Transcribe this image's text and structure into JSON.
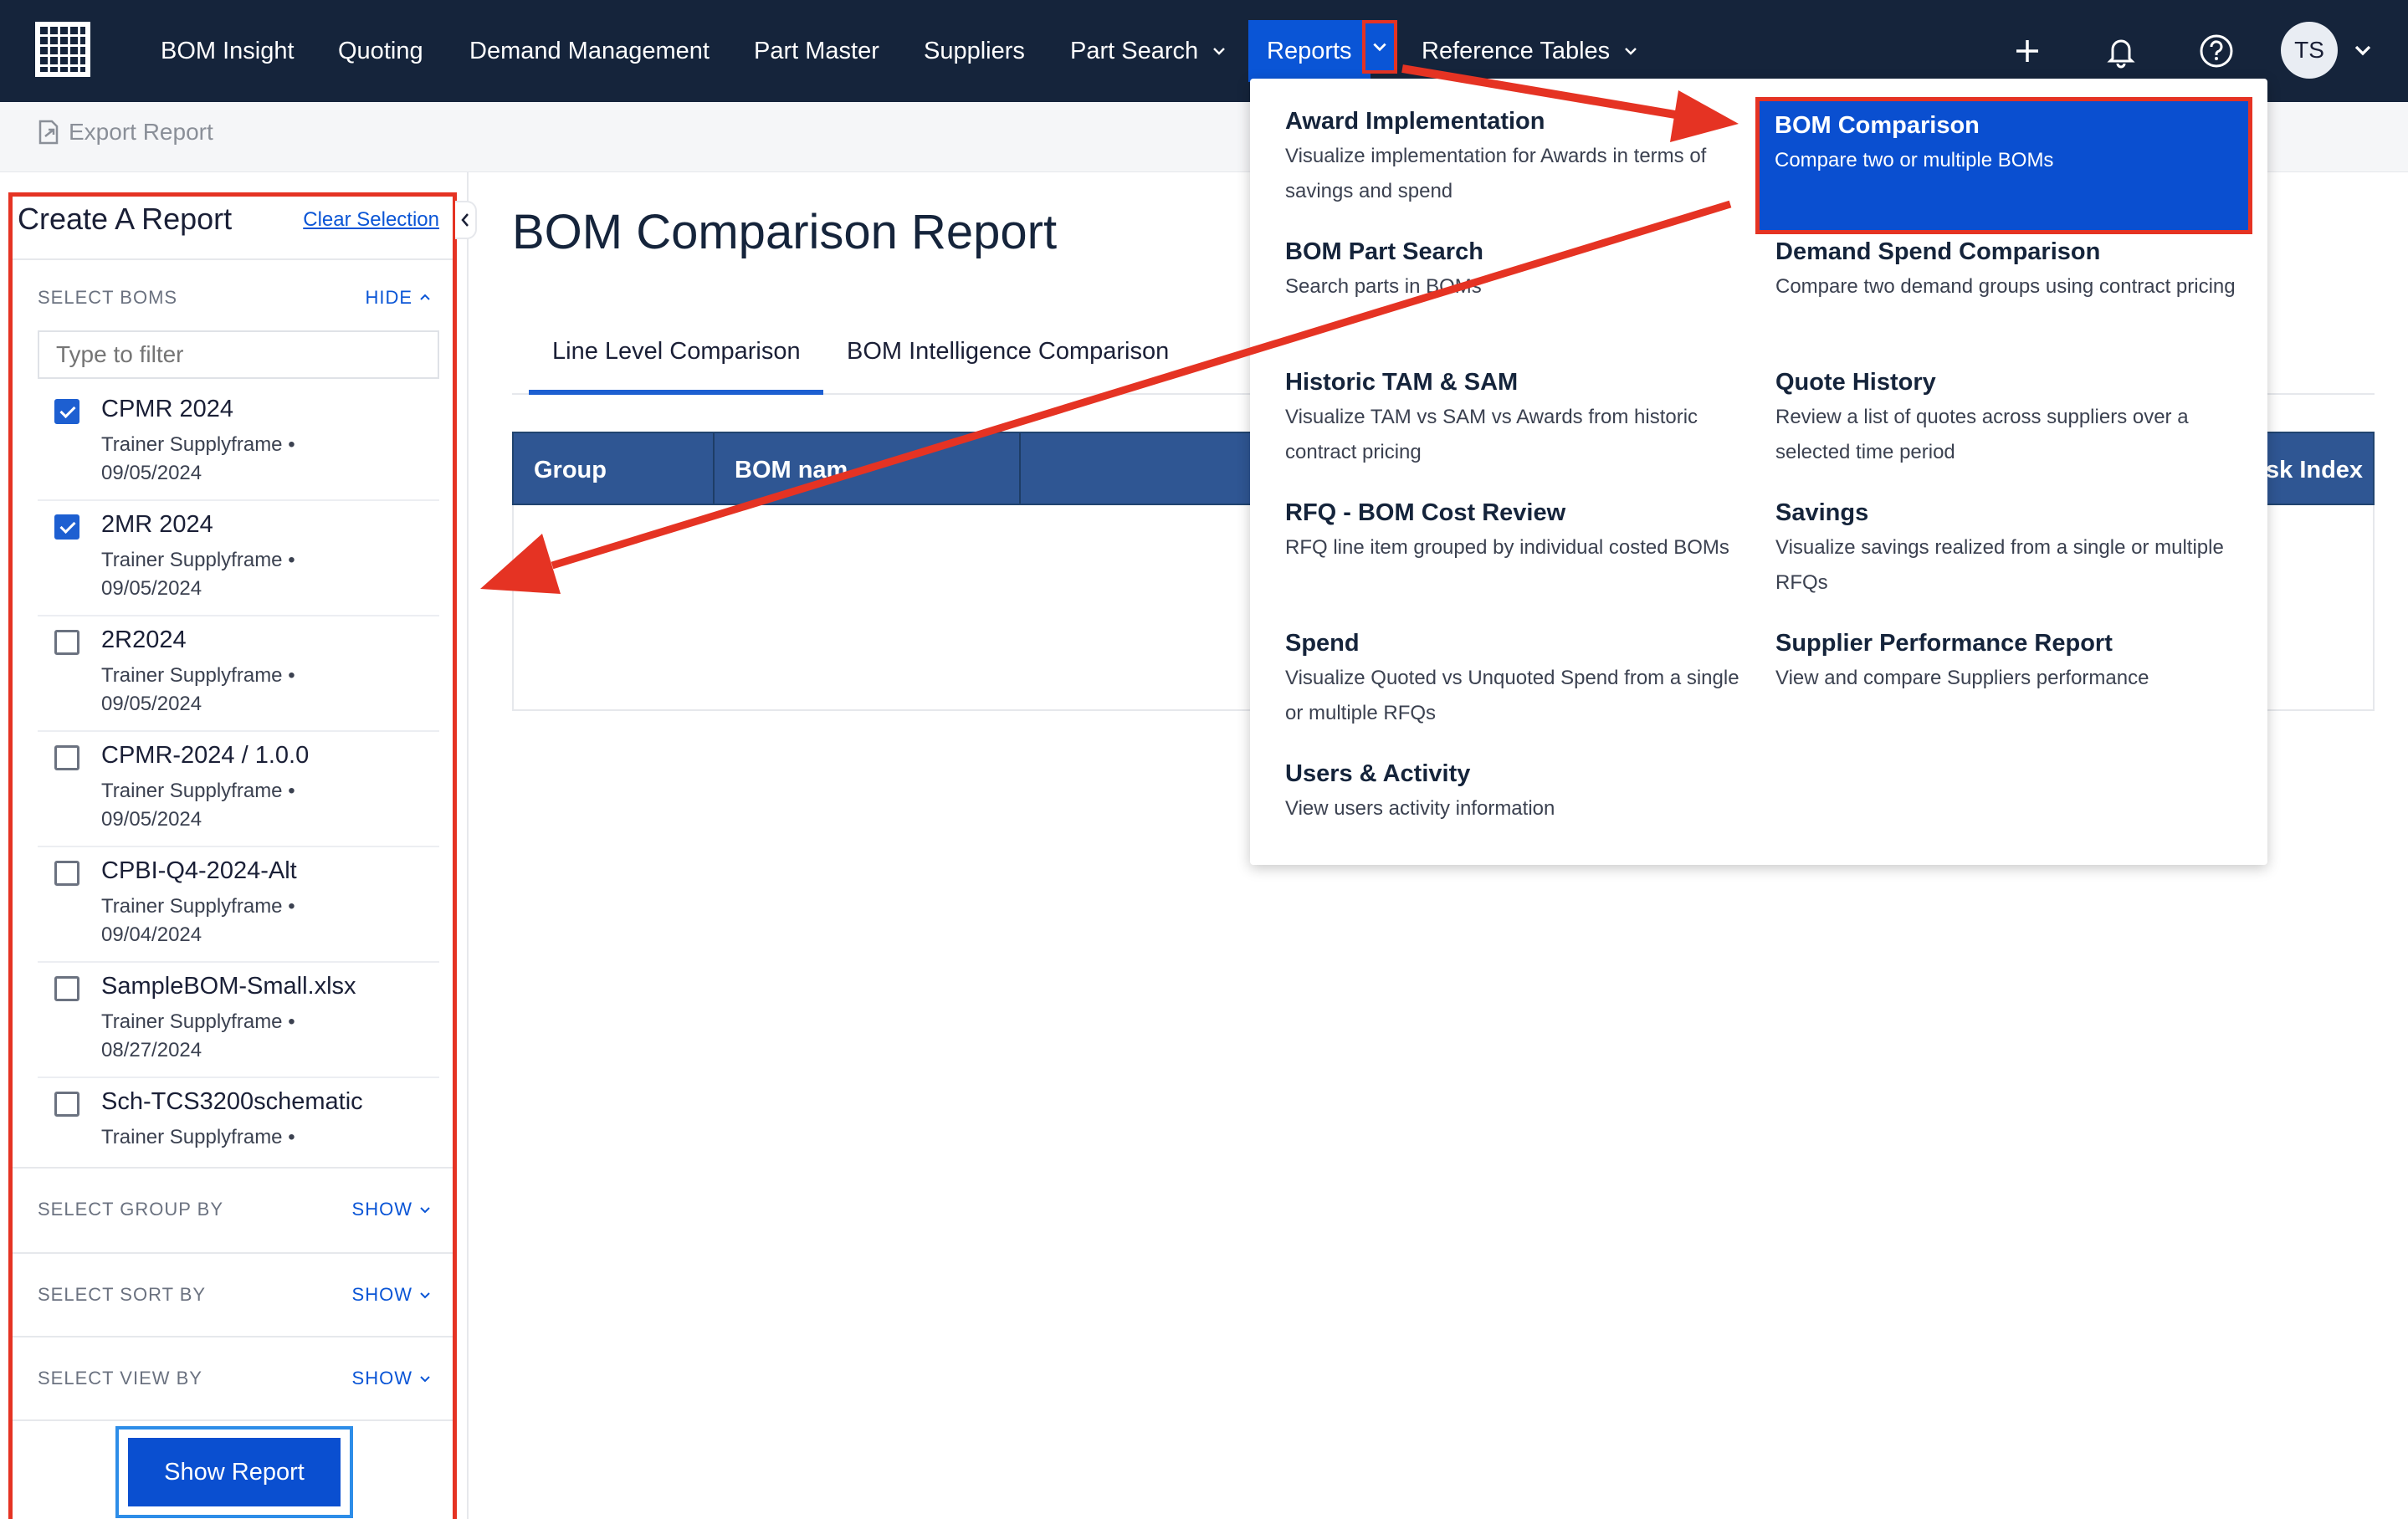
{
  "nav": {
    "items": [
      "BOM Insight",
      "Quoting",
      "Demand Management",
      "Part Master",
      "Suppliers",
      "Part Search",
      "Reports",
      "Reference Tables"
    ],
    "avatar_initials": "TS"
  },
  "toolbar": {
    "export_label": "Export Report"
  },
  "sidebar": {
    "title": "Create A Report",
    "clear_label": "Clear Selection",
    "select_boms": {
      "label": "SELECT BOMS",
      "toggle": "HIDE"
    },
    "filter_placeholder": "Type to filter",
    "boms": [
      {
        "name": "CPMR 2024",
        "owner": "Trainer Supplyframe •",
        "date": "09/05/2024",
        "checked": true
      },
      {
        "name": "2MR 2024",
        "owner": "Trainer Supplyframe •",
        "date": "09/05/2024",
        "checked": true
      },
      {
        "name": "2R2024",
        "owner": "Trainer Supplyframe •",
        "date": "09/05/2024",
        "checked": false
      },
      {
        "name": "CPMR-2024 / 1.0.0",
        "owner": "Trainer Supplyframe •",
        "date": "09/05/2024",
        "checked": false
      },
      {
        "name": "CPBI-Q4-2024-Alt",
        "owner": "Trainer Supplyframe •",
        "date": "09/04/2024",
        "checked": false
      },
      {
        "name": "SampleBOM-Small.xlsx",
        "owner": "Trainer Supplyframe •",
        "date": "08/27/2024",
        "checked": false
      },
      {
        "name": "Sch-TCS3200schematic",
        "owner": "Trainer Supplyframe •",
        "date": "",
        "checked": false
      }
    ],
    "group_by": {
      "label": "SELECT GROUP BY",
      "toggle": "SHOW"
    },
    "sort_by": {
      "label": "SELECT SORT BY",
      "toggle": "SHOW"
    },
    "view_by": {
      "label": "SELECT VIEW BY",
      "toggle": "SHOW"
    },
    "show_report_label": "Show Report"
  },
  "main": {
    "title": "BOM Comparison Report",
    "tabs": [
      "Line Level Comparison",
      "BOM Intelligence Comparison"
    ],
    "active_tab": 0,
    "table_headers": [
      "Group",
      "BOM nam",
      "sk Index"
    ]
  },
  "reports_menu": {
    "items": [
      {
        "title": "Award Implementation",
        "desc": "Visualize implementation for Awards in terms of savings and spend"
      },
      {
        "title": "BOM Comparison",
        "desc": "Compare two or multiple BOMs",
        "active": true
      },
      {
        "title": "BOM Part Search",
        "desc": "Search parts in BOMs"
      },
      {
        "title": "Demand Spend Comparison",
        "desc": "Compare two demand groups using contract pricing"
      },
      {
        "title": "Historic TAM & SAM",
        "desc": "Visualize TAM vs SAM vs Awards from historic contract pricing"
      },
      {
        "title": "Quote History",
        "desc": "Review a list of quotes across suppliers over a selected time period"
      },
      {
        "title": "RFQ - BOM Cost Review",
        "desc": "RFQ line item grouped by individual costed BOMs"
      },
      {
        "title": "Savings",
        "desc": "Visualize savings realized from a single or multiple RFQs"
      },
      {
        "title": "Spend",
        "desc": "Visualize Quoted vs Unquoted Spend from a single or multiple RFQs"
      },
      {
        "title": "Supplier Performance Report",
        "desc": "View and compare Suppliers performance"
      },
      {
        "title": "Users & Activity",
        "desc": "View users activity information"
      }
    ]
  },
  "colors": {
    "nav_bg": "#15243b",
    "accent": "#0a4fd0",
    "annotation_red": "#e53323",
    "highlight_blue": "#2d8de8",
    "table_header": "#2f5693"
  }
}
